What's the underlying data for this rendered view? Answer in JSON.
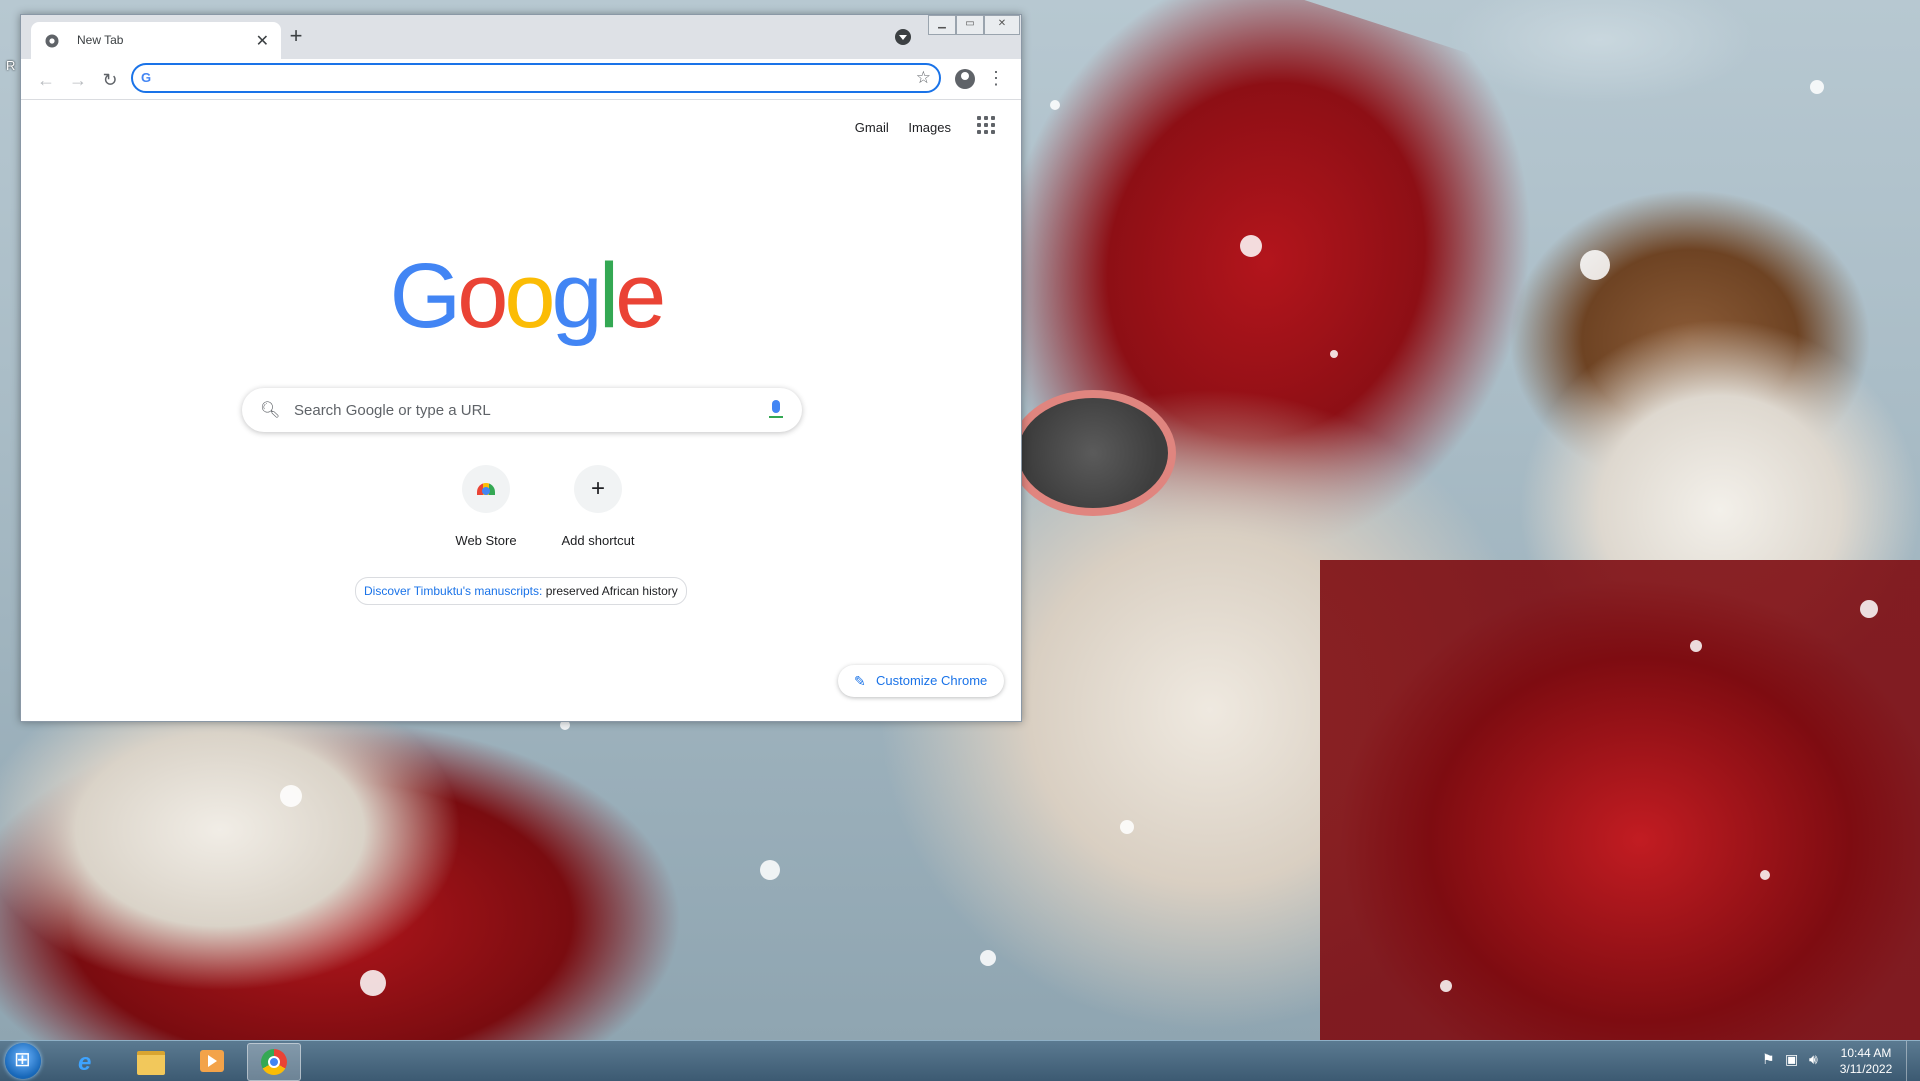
{
  "desktop": {
    "edge_text": "R"
  },
  "browser": {
    "tab": {
      "title": "New Tab"
    },
    "omnibox": {
      "value": "",
      "placeholder": ""
    }
  },
  "ntp": {
    "top_links": {
      "gmail": "Gmail",
      "images": "Images"
    },
    "logo_text": "Google",
    "search_placeholder": "Search Google or type a URL",
    "shortcuts": [
      {
        "label": "Web Store",
        "icon": "webstore-icon"
      },
      {
        "label": "Add shortcut",
        "icon": "plus-icon"
      }
    ],
    "promo": {
      "link": "Discover Timbuktu's manuscripts:",
      "text": "preserved African history"
    },
    "customize_label": "Customize Chrome"
  },
  "taskbar": {
    "clock": {
      "time": "10:44 AM",
      "date": "3/11/2022"
    },
    "apps": [
      "internet-explorer",
      "file-explorer",
      "media-player",
      "chrome"
    ]
  },
  "colors": {
    "google_blue": "#4285f4",
    "google_red": "#ea4335",
    "google_yellow": "#fbbc05",
    "google_green": "#34a853",
    "link_blue": "#1a73e8"
  }
}
